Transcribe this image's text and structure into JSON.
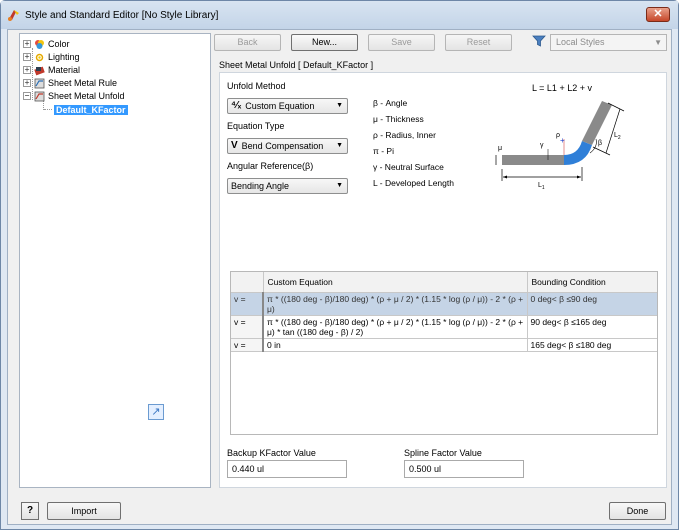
{
  "window": {
    "title": "Style and Standard Editor [No Style Library]",
    "close_label": "✕"
  },
  "tree": {
    "items": [
      {
        "label": "Color",
        "icon": "color-icon",
        "expander": "+"
      },
      {
        "label": "Lighting",
        "icon": "lighting-icon",
        "expander": "+"
      },
      {
        "label": "Material",
        "icon": "material-icon",
        "expander": "+"
      },
      {
        "label": "Sheet Metal Rule",
        "icon": "sheet-metal-rule-icon",
        "expander": "+"
      },
      {
        "label": "Sheet Metal Unfold",
        "icon": "sheet-metal-unfold-icon",
        "expander": "−"
      },
      {
        "label": "Default_KFactor",
        "icon": "",
        "expander": ""
      }
    ]
  },
  "toolbar": {
    "back_label": "Back",
    "new_label": "New...",
    "save_label": "Save",
    "reset_label": "Reset",
    "filter_value": "Local Styles"
  },
  "section_title": "Sheet Metal Unfold [ Default_KFactor ]",
  "form": {
    "unfold_method_label": "Unfold Method",
    "unfold_method_value": "Custom Equation",
    "equation_type_label": "Equation Type",
    "equation_type_value": "Bend Compensation",
    "angular_reference_label": "Angular Reference(β)",
    "angular_reference_value": "Bending Angle"
  },
  "legend": [
    "β - Angle",
    "μ - Thickness",
    "ρ - Radius, Inner",
    "π - Pi",
    "γ - Neutral Surface",
    "L - Developed Length"
  ],
  "diagram": {
    "formula": "L = L1 + L2 + v",
    "labels": {
      "mu": "μ",
      "gamma": "γ",
      "rho": "ρ",
      "beta": "β",
      "l1": "L",
      "l2": "L",
      "l1_sub": "1",
      "l2_sub": "2"
    }
  },
  "table": {
    "columns": [
      "",
      "Custom Equation",
      "Bounding Condition"
    ],
    "rows": [
      {
        "head": "v =",
        "equation": "π * ((180 deg - β)/180 deg) * (ρ + μ / 2) * (1.15 * log (ρ / μ)) - 2 * (ρ + μ)",
        "condition": "0 deg< β ≤90 deg"
      },
      {
        "head": "v =",
        "equation": "π * ((180 deg - β)/180 deg) * (ρ + μ / 2) * (1.15 * log (ρ / μ)) - 2 * (ρ + μ) * tan ((180 deg - β) / 2)",
        "condition": "90 deg< β ≤165 deg"
      },
      {
        "head": "v =",
        "equation": "0 in",
        "condition": "165 deg< β ≤180 deg"
      }
    ]
  },
  "backup_kfactor": {
    "label": "Backup KFactor Value",
    "value": "0.440 ul"
  },
  "spline_factor": {
    "label": "Spline Factor Value",
    "value": "0.500 ul"
  },
  "footer": {
    "help_label": "?",
    "import_label": "Import",
    "done_label": "Done"
  }
}
